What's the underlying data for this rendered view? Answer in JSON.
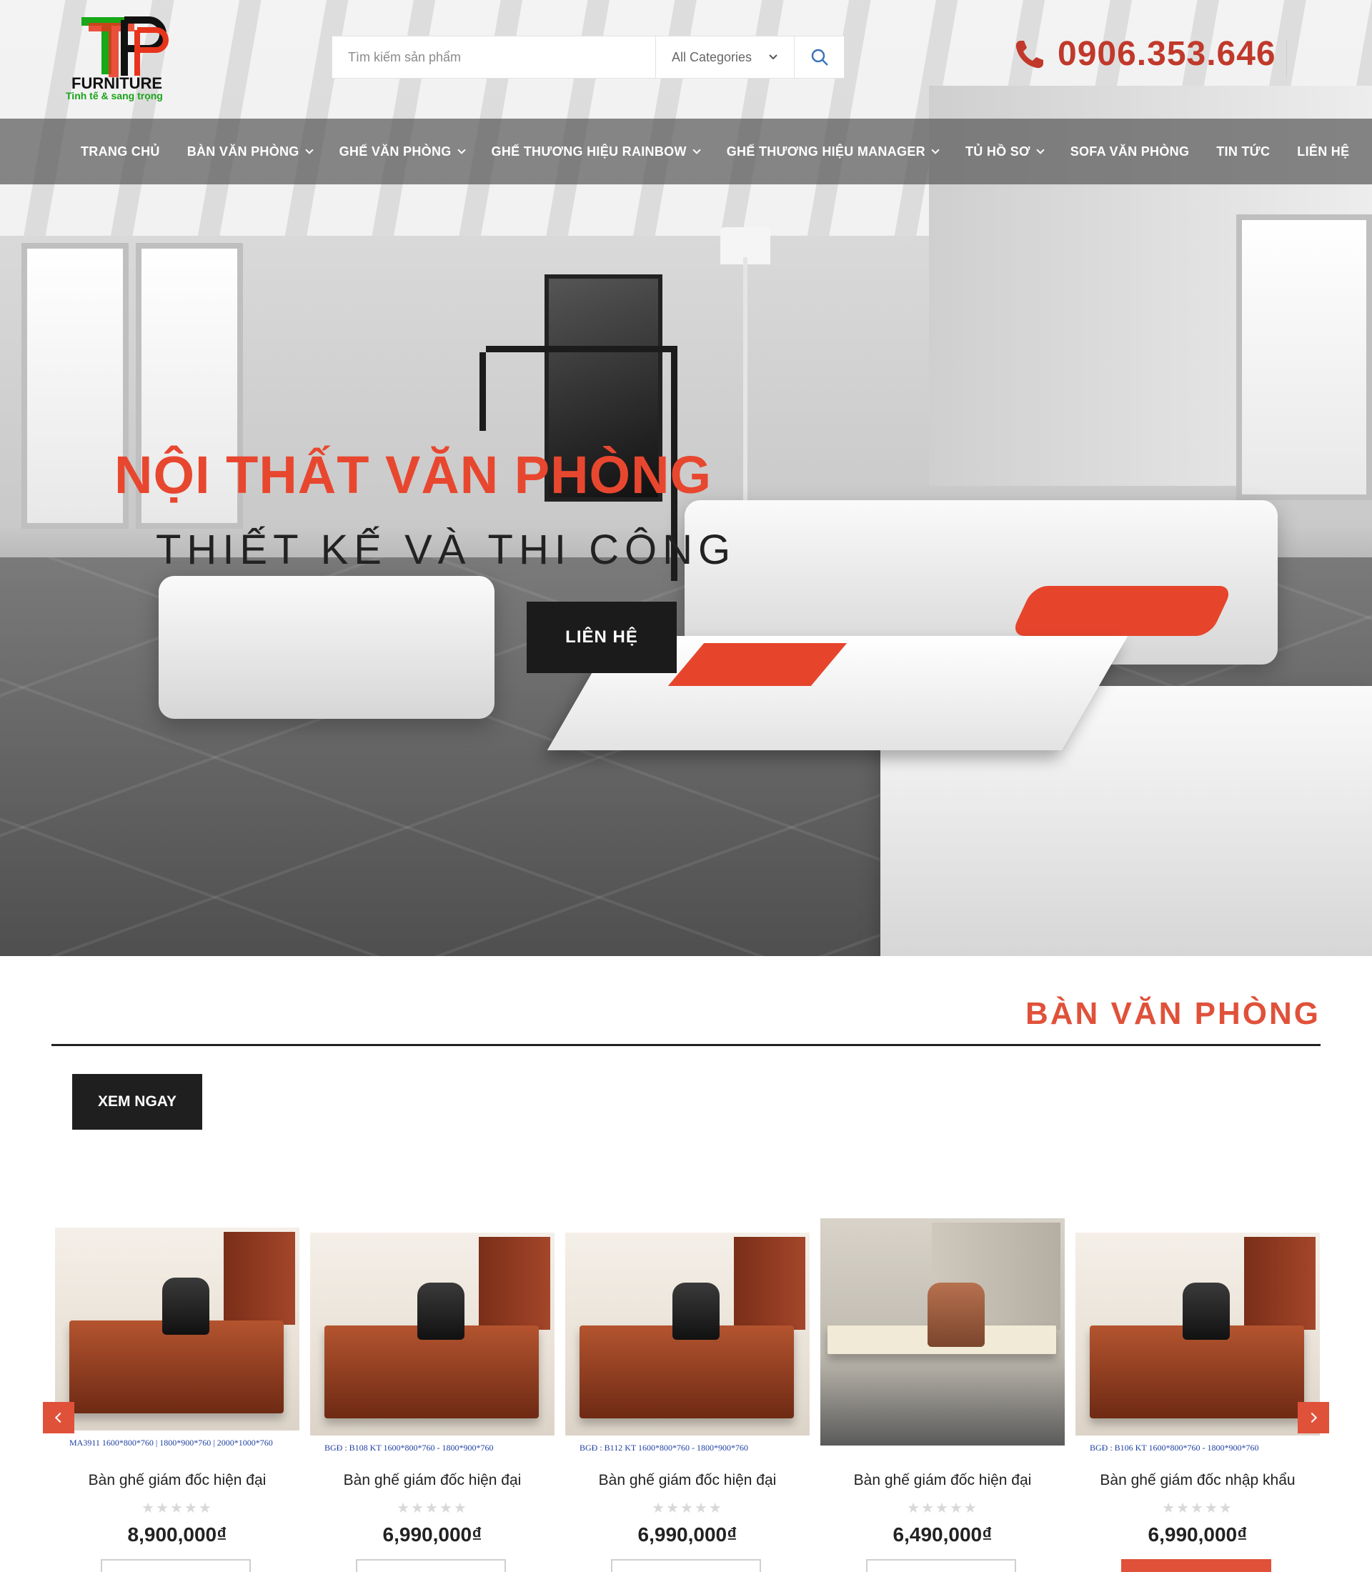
{
  "header": {
    "logo_text": "FURNITURE",
    "logo_tagline": "Tinh tế & sang trọng",
    "search_placeholder": "Tìm kiếm sản phẩm",
    "category_select": "All Categories",
    "phone": "0906.353.646"
  },
  "nav": [
    {
      "label": "TRANG CHỦ",
      "dropdown": false
    },
    {
      "label": "BÀN VĂN PHÒNG",
      "dropdown": true
    },
    {
      "label": "GHẾ VĂN PHÒNG",
      "dropdown": true
    },
    {
      "label": "GHẾ THƯƠNG HIỆU RAINBOW",
      "dropdown": true
    },
    {
      "label": "GHẾ THƯƠNG HIỆU MANAGER",
      "dropdown": true
    },
    {
      "label": "TỦ HỒ SƠ",
      "dropdown": true
    },
    {
      "label": "SOFA VĂN PHÒNG",
      "dropdown": false
    },
    {
      "label": "TIN TỨC",
      "dropdown": false
    },
    {
      "label": "LIÊN HỆ",
      "dropdown": false
    }
  ],
  "hero": {
    "title": "NỘI THẤT VĂN PHÒNG",
    "subtitle": "THIẾT KẾ VÀ THI CÔNG",
    "button": "LIÊN HỆ"
  },
  "section": {
    "title": "BÀN VĂN PHÒNG",
    "button": "XEM NGAY"
  },
  "products": [
    {
      "name": "Bàn ghế giám đốc hiện đại",
      "price": "8,900,000₫",
      "rating": 0,
      "image_label": "MA3911   1600*800*760  |  1800*900*760  |  2000*1000*760"
    },
    {
      "name": "Bàn ghế giám đốc hiện đại",
      "price": "6,990,000₫",
      "rating": 0,
      "image_label": "BGĐ : B108    KT 1600*800*760 - 1800*900*760"
    },
    {
      "name": "Bàn ghế giám đốc hiện đại",
      "price": "6,990,000₫",
      "rating": 0,
      "image_label": "BGĐ : B112    KT 1600*800*760 - 1800*900*760"
    },
    {
      "name": "Bàn ghế giám đốc hiện đại",
      "price": "6,490,000₫",
      "rating": 0,
      "image_label": ""
    },
    {
      "name": "Bàn ghế giám đốc nhập khẩu",
      "price": "6,990,000₫",
      "rating": 0,
      "image_label": "BGĐ : B106    KT 1600*800*760 - 1800*900*760"
    }
  ],
  "colors": {
    "accent": "#e0513a",
    "phone": "#c0392b",
    "dark": "#1b1b1b"
  }
}
